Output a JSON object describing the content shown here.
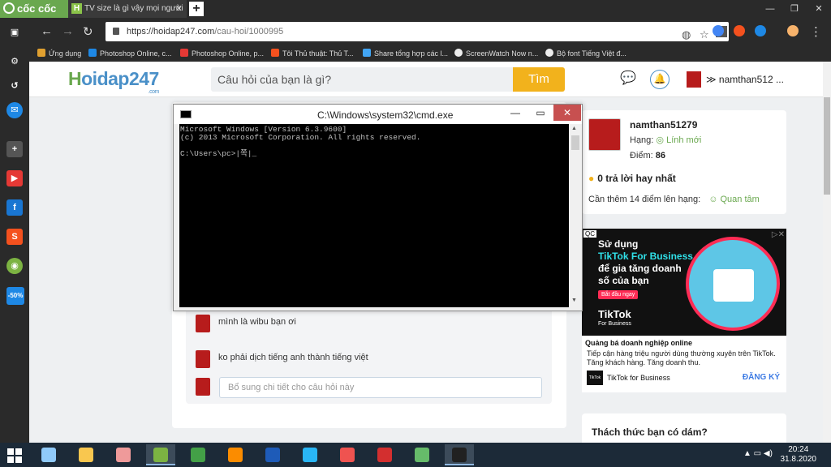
{
  "browser": {
    "brand": "cốc cốc",
    "tab_title": "TV size là gì vậy mọi người",
    "tab_favicon": "H",
    "new_tab": "+",
    "window_controls": [
      "—",
      "❐",
      "✕"
    ],
    "url_host": "https://hoidap247.com",
    "url_path": "/cau-hoi/1000995",
    "bookmarks": [
      {
        "label": "Ứng dụng",
        "color": "#e0a030"
      },
      {
        "label": "Photoshop Online, c...",
        "color": "#1e88e5"
      },
      {
        "label": "Photoshop Online, p...",
        "color": "#e53935"
      },
      {
        "label": "Tôi Thủ thuật: Thủ T...",
        "color": "#f4511e"
      },
      {
        "label": "Share tổng hợp các l...",
        "color": "#42a5f5"
      },
      {
        "label": "ScreenWatch Now n...",
        "color": "#eeeeee"
      },
      {
        "label": "Bộ font Tiếng Việt đ...",
        "color": "#eeeeee"
      }
    ]
  },
  "sidebar_icons": [
    {
      "name": "home-icon",
      "color": "#2a2a2a",
      "glyph": "▣"
    },
    {
      "name": "settings-icon",
      "color": "#2a2a2a",
      "glyph": "⚙"
    },
    {
      "name": "history-icon",
      "color": "#2a2a2a",
      "glyph": "↺"
    },
    {
      "name": "messenger-icon",
      "color": "#1e88e5",
      "glyph": "✉"
    },
    {
      "name": "add-icon",
      "color": "#555555",
      "glyph": "+"
    },
    {
      "name": "youtube-icon",
      "color": "#e53935",
      "glyph": "▶"
    },
    {
      "name": "facebook-icon",
      "color": "#1976d2",
      "glyph": "f"
    },
    {
      "name": "shopee-icon",
      "color": "#f4511e",
      "glyph": "S"
    },
    {
      "name": "coccoc-game-icon",
      "color": "#7cb342",
      "glyph": "◉"
    },
    {
      "name": "tiki-icon",
      "color": "#1e88e5",
      "glyph": "-50%"
    }
  ],
  "site": {
    "logo_h": "H",
    "logo_rest": "oidap247",
    "logo_com": ".com",
    "search_placeholder": "Câu hỏi của bạn là gì?",
    "search_button": "Tìm",
    "username_short": "namthan512 ..."
  },
  "comments": [
    {
      "text": "mình là wibu bạn ơi"
    },
    {
      "text": "ko phải dịch tiếng anh thành tiếng việt"
    }
  ],
  "comment_input_placeholder": "Bổ sung chi tiết cho câu hỏi này",
  "profile": {
    "name": "namthan51279",
    "rank_label": "Hạng:",
    "rank_value": "Lính mới",
    "points_label": "Điểm:",
    "points_value": "86",
    "best_answers": "0 trả lời hay nhất",
    "need_more": "Cần thêm 14 điểm lên hạng:",
    "follow": "Quan tâm"
  },
  "ad": {
    "qc": "QC",
    "line1": "Sử dụng",
    "line2": "TikTok For Business",
    "line3": "để gia tăng doanh",
    "line4": "số của bạn",
    "cta": "Bắt đầu ngay",
    "brand_big": "TikTok",
    "brand_sub": "For Business",
    "headline": "Quảng bá doanh nghiệp online",
    "desc": "Tiếp cận hàng triệu người dùng thường xuyên trên TikTok. Tăng khách hàng. Tăng doanh thu.",
    "logo_text": "TikTok",
    "advertiser": "TikTok for Business",
    "register": "ĐĂNG KÝ"
  },
  "challenge_title": "Thách thức bạn có dám?",
  "cmd": {
    "title": "C:\\Windows\\system32\\cmd.exe",
    "output": "Microsoft Windows [Version 6.3.9600]\n(c) 2013 Microsoft Corporation. All rights reserved.\n\nC:\\Users\\pc>|쪽|_"
  },
  "taskbar": {
    "apps": [
      {
        "name": "taskbar-app-notepad",
        "color": "#90caf9",
        "active": false
      },
      {
        "name": "taskbar-app-explorer",
        "color": "#f9c74f",
        "active": false
      },
      {
        "name": "taskbar-app-snipping",
        "color": "#ef9a9a",
        "active": false
      },
      {
        "name": "taskbar-app-coccoc",
        "color": "#7cb342",
        "active": true
      },
      {
        "name": "taskbar-app-chrome",
        "color": "#43a047",
        "active": false
      },
      {
        "name": "taskbar-app-avast",
        "color": "#fb8c00",
        "active": false
      },
      {
        "name": "taskbar-app-word",
        "color": "#1e5bb8",
        "active": false
      },
      {
        "name": "taskbar-app-ie",
        "color": "#29b6f6",
        "active": false
      },
      {
        "name": "taskbar-app-paint",
        "color": "#ef5350",
        "active": false
      },
      {
        "name": "taskbar-app-opera",
        "color": "#d32f2f",
        "active": false
      },
      {
        "name": "taskbar-app-gpu",
        "color": "#66bb6a",
        "active": false
      },
      {
        "name": "taskbar-app-cmd",
        "color": "#212121",
        "active": true
      }
    ],
    "time": "20:24",
    "date": "31.8.2020",
    "tray": "▲  ▭  ◀)"
  }
}
